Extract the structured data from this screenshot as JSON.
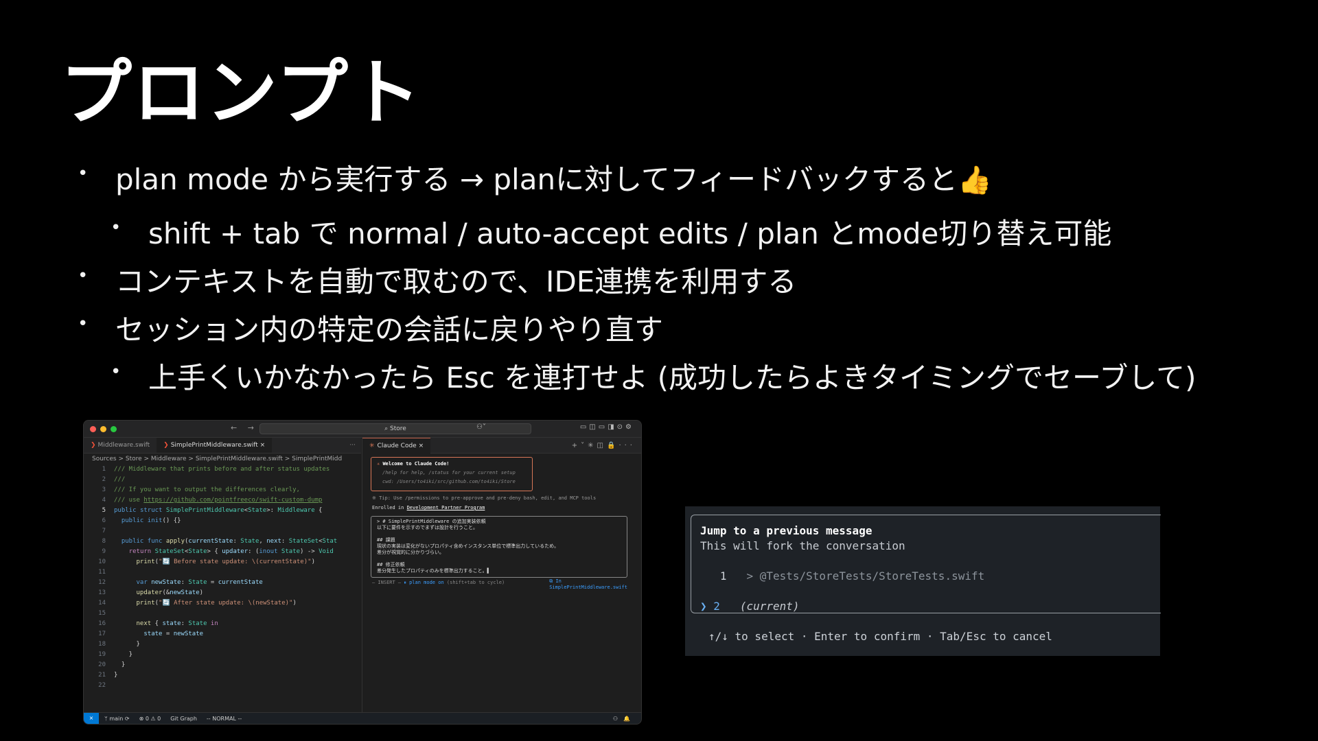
{
  "title": "プロンプト",
  "bullets": [
    {
      "text": "plan mode から実行する → planに対してフィードバックすると",
      "emoji": "👍"
    },
    {
      "text": "shift + tab で normal / auto-accept edits / plan とmode切り替え可能"
    },
    {
      "text": "コンテキストを自動で取むので、IDE連携を利用する"
    },
    {
      "text": "セッション内の特定の会話に戻りやり直す"
    },
    {
      "text": "上手くいかなかったら Esc を連打せよ (成功したらよきタイミングでセーブして)"
    }
  ],
  "bullet_char": "•",
  "ide": {
    "search": "⌕ Store",
    "nav": "← →",
    "tabs": [
      "Middleware.swift",
      "SimplePrintMiddleware.swift ×"
    ],
    "tab_more": "···",
    "breadcrumb": "Sources > Store > Middleware > SimplePrintMiddleware.swift > SimplePrintMidd",
    "claude_tab": "Claude Code ×",
    "welcome": {
      "line1_bold": "Welcome to Claude Code!",
      "line2": "/help for help, /status for your current setup",
      "line3": "cwd: /Users/to4iki/src/github.com/to4iki/Store"
    },
    "tip": "※ Tip: Use /permissions to pre-approve and pre-deny bash, edit, and MCP tools",
    "enrolled_prefix": "Enrolled in ",
    "enrolled_link": "Development Partner Program",
    "input_lines": [
      "> # SimplePrintMiddleware の追加実装依頼",
      "  以下に要件を示すのでまずは設計を行うこと。",
      "",
      "  ## 課題",
      "  現状の実装は変化がないプロパティ含めインスタンス単位で標準出力しているため。",
      "  差分が視覚的に分かりづらい。",
      "",
      "  ## 修正依頼",
      "  差分発生したプロパティのみを標準出力すること。▌"
    ],
    "mode_prefix": "— INSERT —",
    "mode_label": "⏸ plan mode on",
    "mode_suffix": "(shift+tab to cycle)",
    "in_file_1": "⧉ In",
    "in_file_2": "SimplePrintMiddleware.swift",
    "status": {
      "branch": "ᛘ main ⟳",
      "problems": "⊗ 0 ⚠ 0",
      "git_graph": "Git Graph",
      "mode": "-- NORMAL --"
    }
  },
  "jump": {
    "title": "Jump to a previous message",
    "subtitle": "This will fork the conversation",
    "row1_num": "1",
    "row1_path": "> @Tests/StoreTests/StoreTests.swift",
    "row2_marker": "❯ 2",
    "row2_label": "(current)",
    "hint": "↑/↓ to select · Enter to confirm · Tab/Esc to cancel"
  }
}
